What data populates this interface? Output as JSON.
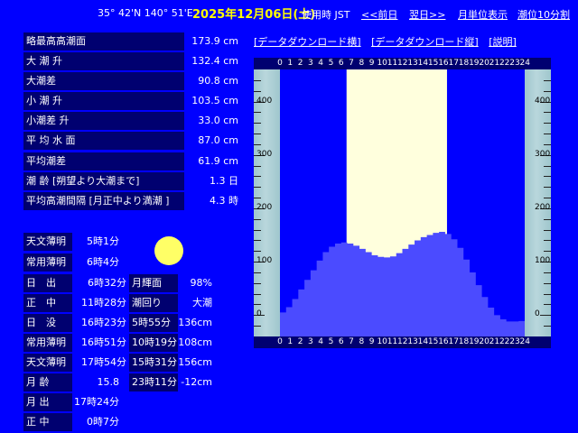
{
  "header": {
    "coords": "35° 42'N 140° 51'E",
    "date": "2025年12月06日(土)",
    "timezone": "使用時 JST",
    "prev": "<<前日",
    "next": "翌日>>",
    "monthly": "月単位表示",
    "tide_interval": "潮位10分割"
  },
  "summary": [
    {
      "label": "略最高高潮面",
      "value": "173.9 cm"
    },
    {
      "label": "大 潮 升",
      "value": "132.4 cm"
    },
    {
      "label": "大潮差",
      "value": "90.8 cm"
    },
    {
      "label": "小 潮 升",
      "value": "103.5 cm"
    },
    {
      "label": "小潮差 升",
      "value": "33.0 cm"
    },
    {
      "label": "平 均 水 面",
      "value": "87.0 cm"
    },
    {
      "label": "平均潮差",
      "value": "61.9 cm"
    },
    {
      "label": "潮 齢 [朔望より大潮まで]",
      "value": "1.3 日"
    },
    {
      "label": "平均高潮間隔 [月正中より満潮 ]",
      "value": "4.3 時"
    }
  ],
  "sun_moon": {
    "astro_dawn": {
      "label": "天文薄明",
      "value": "5時1分"
    },
    "civil_dawn": {
      "label": "常用薄明",
      "value": "6時4分"
    },
    "sunrise": {
      "label": "日　出",
      "value": "6時32分"
    },
    "noon": {
      "label": "正　中",
      "value": "11時28分"
    },
    "sunset": {
      "label": "日　没",
      "value": "16時23分"
    },
    "civil_dusk": {
      "label": "常用薄明",
      "value": "16時51分"
    },
    "astro_dusk": {
      "label": "天文薄明",
      "value": "17時54分"
    },
    "moon_age": {
      "label": "月 齢",
      "value": "15.8"
    },
    "moonrise": {
      "label": "月 出",
      "value": "17時24分"
    },
    "moon_transit": {
      "label": "正 中",
      "value": "0時7分"
    },
    "moon_brightness": {
      "label": "月輝面",
      "value": "98%"
    },
    "tide_type": {
      "label": "潮回り",
      "value": "大潮"
    }
  },
  "tides": [
    {
      "time": "5時55分",
      "height": "136cm"
    },
    {
      "time": "10時19分",
      "height": "108cm"
    },
    {
      "time": "15時31分",
      "height": "156cm"
    },
    {
      "time": "23時11分",
      "height": "-12cm"
    }
  ],
  "links": {
    "dl_horizontal": "[データダウンロード横]",
    "dl_vertical": "[データダウンロード縦]",
    "explain": "[説明]"
  },
  "chart_data": {
    "type": "area",
    "xlabel": "",
    "ylabel": "",
    "x": [
      0,
      0.5,
      1,
      1.5,
      2,
      2.5,
      3,
      3.5,
      4,
      4.5,
      5,
      5.5,
      6,
      6.5,
      7,
      7.5,
      8,
      8.5,
      9,
      9.5,
      10,
      10.5,
      11,
      11.5,
      12,
      12.5,
      13,
      13.5,
      14,
      14.5,
      15,
      15.5,
      16,
      16.5,
      17,
      17.5,
      18,
      18.5,
      19,
      19.5,
      20,
      20.5,
      21,
      21.5,
      22,
      22.5,
      23,
      23.5,
      24
    ],
    "y": [
      5,
      15,
      30,
      48,
      66,
      84,
      102,
      118,
      128,
      134,
      136,
      134,
      130,
      124,
      118,
      112,
      109,
      108,
      110,
      116,
      124,
      132,
      140,
      146,
      150,
      154,
      156,
      152,
      142,
      126,
      104,
      80,
      56,
      34,
      14,
      0,
      -8,
      -12,
      -12,
      -11
    ],
    "xlim": [
      0,
      24
    ],
    "ylim": [
      -40,
      460
    ],
    "yticks": [
      0,
      100,
      200,
      300,
      400
    ],
    "xticks": [
      0,
      1,
      2,
      3,
      4,
      5,
      6,
      7,
      8,
      9,
      10,
      11,
      12,
      13,
      14,
      15,
      16,
      17,
      18,
      19,
      20,
      21,
      22,
      23,
      24
    ],
    "day_start_hour": 6.53,
    "day_end_hour": 16.38,
    "colors": {
      "water": "#4b4bff",
      "day": "#ffffdd",
      "night": "#0000ff",
      "gauge": "#b9d7dc"
    }
  }
}
